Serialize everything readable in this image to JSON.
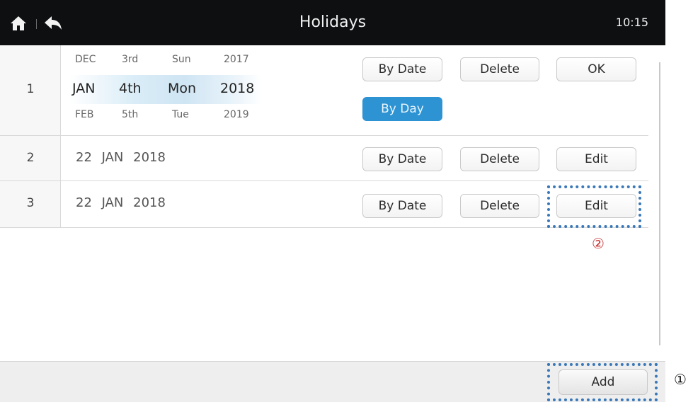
{
  "header": {
    "title": "Holidays",
    "clock": "10:15",
    "home_icon": "home-icon",
    "back_icon": "back-arrow-icon"
  },
  "row1": {
    "number": "1",
    "picker": {
      "months": [
        "DEC",
        "JAN",
        "FEB"
      ],
      "days": [
        "3rd",
        "4th",
        "5th"
      ],
      "weekdays": [
        "Sun",
        "Mon",
        "Tue"
      ],
      "years": [
        "2017",
        "2018",
        "2019"
      ],
      "selected_index": 1
    },
    "buttons": {
      "by_date": "By Date",
      "delete": "Delete",
      "ok": "OK",
      "by_day": "By Day"
    }
  },
  "row2": {
    "number": "2",
    "date": "22 JAN 2018",
    "buttons": {
      "by_date": "By Date",
      "delete": "Delete",
      "edit": "Edit"
    }
  },
  "row3": {
    "number": "3",
    "date": "22 JAN 2018",
    "buttons": {
      "by_date": "By Date",
      "delete": "Delete",
      "edit": "Edit"
    }
  },
  "footer": {
    "add": "Add"
  },
  "annotations": {
    "edit_marker": "②",
    "add_marker": "①"
  },
  "colors": {
    "header_bg": "#0d0f11",
    "accent_blue": "#2d93d3",
    "annotation_dash": "#3a78b8",
    "annotation_red": "#c83030"
  }
}
